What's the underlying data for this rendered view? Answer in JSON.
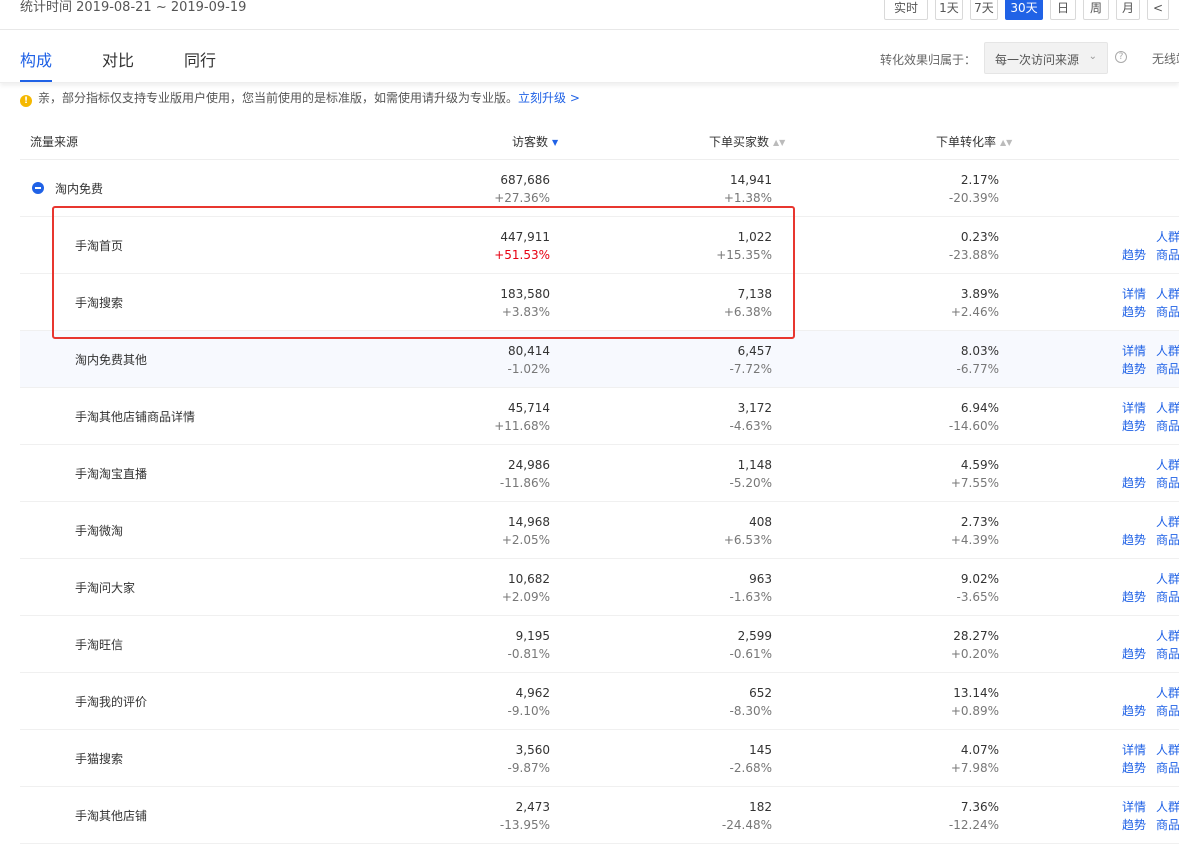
{
  "header": {
    "stat_time": "统计时间 2019-08-21 ~ 2019-09-19",
    "periods": [
      "实时",
      "1天",
      "7天",
      "30天",
      "日",
      "周",
      "月",
      "<"
    ],
    "active_period": "30天"
  },
  "tabs": [
    {
      "label": "构成",
      "active": true
    },
    {
      "label": "对比",
      "active": false
    },
    {
      "label": "同行",
      "active": false
    }
  ],
  "attribution": {
    "label": "转化效果归属于：",
    "selected": "每一次访问来源",
    "extra": "无线端"
  },
  "notice": {
    "text": "亲，部分指标仅支持专业版用户使用，您当前使用的是标准版，如需使用请升级为专业版。",
    "link": "立刻升级 >"
  },
  "table": {
    "columns": [
      "流量来源",
      "访客数",
      "下单买家数",
      "下单转化率"
    ],
    "rows": [
      {
        "name": "淘内免费",
        "visitors": "687,686",
        "visitors_delta": "+27.36%",
        "buyers": "14,941",
        "buyers_delta": "+1.38%",
        "rate": "2.17%",
        "rate_delta": "-20.39%",
        "ops": [],
        "parent": true
      },
      {
        "name": "手淘首页",
        "visitors": "447,911",
        "visitors_delta": "+51.53%",
        "visitors_delta_red": true,
        "buyers": "1,022",
        "buyers_delta": "+15.35%",
        "rate": "0.23%",
        "rate_delta": "-23.88%",
        "ops": [
          "人群",
          "趋势",
          "商品"
        ]
      },
      {
        "name": "手淘搜索",
        "visitors": "183,580",
        "visitors_delta": "+3.83%",
        "buyers": "7,138",
        "buyers_delta": "+6.38%",
        "rate": "3.89%",
        "rate_delta": "+2.46%",
        "ops": [
          "详情",
          "人群",
          "趋势",
          "商品"
        ]
      },
      {
        "name": "淘内免费其他",
        "visitors": "80,414",
        "visitors_delta": "-1.02%",
        "buyers": "6,457",
        "buyers_delta": "-7.72%",
        "rate": "8.03%",
        "rate_delta": "-6.77%",
        "ops": [
          "详情",
          "人群",
          "趋势",
          "商品"
        ],
        "alt": true
      },
      {
        "name": "手淘其他店铺商品详情",
        "visitors": "45,714",
        "visitors_delta": "+11.68%",
        "buyers": "3,172",
        "buyers_delta": "-4.63%",
        "rate": "6.94%",
        "rate_delta": "-14.60%",
        "ops": [
          "详情",
          "人群",
          "趋势",
          "商品"
        ]
      },
      {
        "name": "手淘淘宝直播",
        "visitors": "24,986",
        "visitors_delta": "-11.86%",
        "buyers": "1,148",
        "buyers_delta": "-5.20%",
        "rate": "4.59%",
        "rate_delta": "+7.55%",
        "ops": [
          "人群",
          "趋势",
          "商品"
        ]
      },
      {
        "name": "手淘微淘",
        "visitors": "14,968",
        "visitors_delta": "+2.05%",
        "buyers": "408",
        "buyers_delta": "+6.53%",
        "rate": "2.73%",
        "rate_delta": "+4.39%",
        "ops": [
          "人群",
          "趋势",
          "商品"
        ]
      },
      {
        "name": "手淘问大家",
        "visitors": "10,682",
        "visitors_delta": "+2.09%",
        "buyers": "963",
        "buyers_delta": "-1.63%",
        "rate": "9.02%",
        "rate_delta": "-3.65%",
        "ops": [
          "人群",
          "趋势",
          "商品"
        ]
      },
      {
        "name": "手淘旺信",
        "visitors": "9,195",
        "visitors_delta": "-0.81%",
        "buyers": "2,599",
        "buyers_delta": "-0.61%",
        "rate": "28.27%",
        "rate_delta": "+0.20%",
        "ops": [
          "人群",
          "趋势",
          "商品"
        ]
      },
      {
        "name": "手淘我的评价",
        "visitors": "4,962",
        "visitors_delta": "-9.10%",
        "buyers": "652",
        "buyers_delta": "-8.30%",
        "rate": "13.14%",
        "rate_delta": "+0.89%",
        "ops": [
          "人群",
          "趋势",
          "商品"
        ]
      },
      {
        "name": "手猫搜索",
        "visitors": "3,560",
        "visitors_delta": "-9.87%",
        "buyers": "145",
        "buyers_delta": "-2.68%",
        "rate": "4.07%",
        "rate_delta": "+7.98%",
        "ops": [
          "详情",
          "人群",
          "趋势",
          "商品"
        ]
      },
      {
        "name": "手淘其他店铺",
        "visitors": "2,473",
        "visitors_delta": "-13.95%",
        "buyers": "182",
        "buyers_delta": "-24.48%",
        "rate": "7.36%",
        "rate_delta": "-12.24%",
        "ops": [
          "详情",
          "人群",
          "趋势",
          "商品"
        ]
      }
    ]
  }
}
